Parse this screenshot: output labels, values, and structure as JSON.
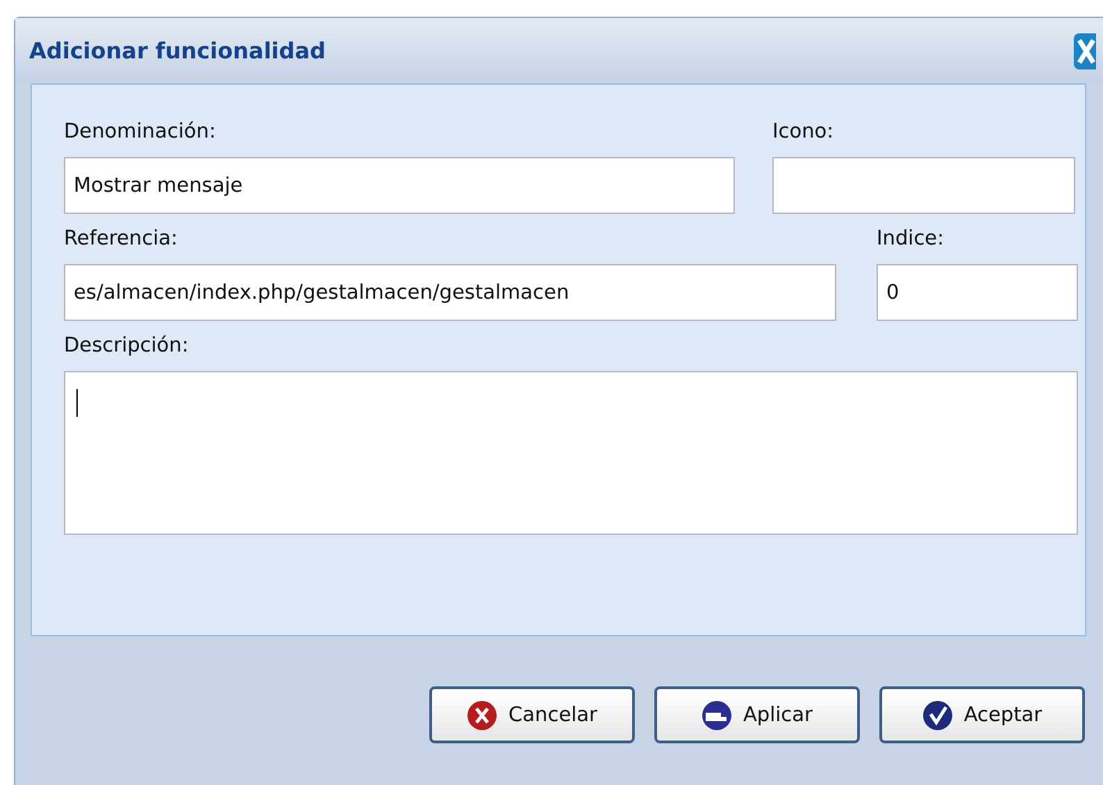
{
  "window": {
    "title": "Adicionar funcionalidad"
  },
  "fields": [
    {
      "label": "Denominación:",
      "value": "Mostrar mensaje"
    },
    {
      "label": "Icono:"
    },
    {
      "label": "Referencia:",
      "value": "es/almacen/index.php/gestalmacen/gestalmacen"
    },
    {
      "label": "Indice:",
      "value": "0"
    }
  ],
  "description": {
    "label": "Descripción:",
    "focused": true
  },
  "buttons": [
    {
      "label": "Cancelar",
      "kind": "cancel"
    },
    {
      "label": "Aplicar",
      "kind": "apply"
    },
    {
      "label": "Aceptar",
      "kind": "accept"
    }
  ]
}
